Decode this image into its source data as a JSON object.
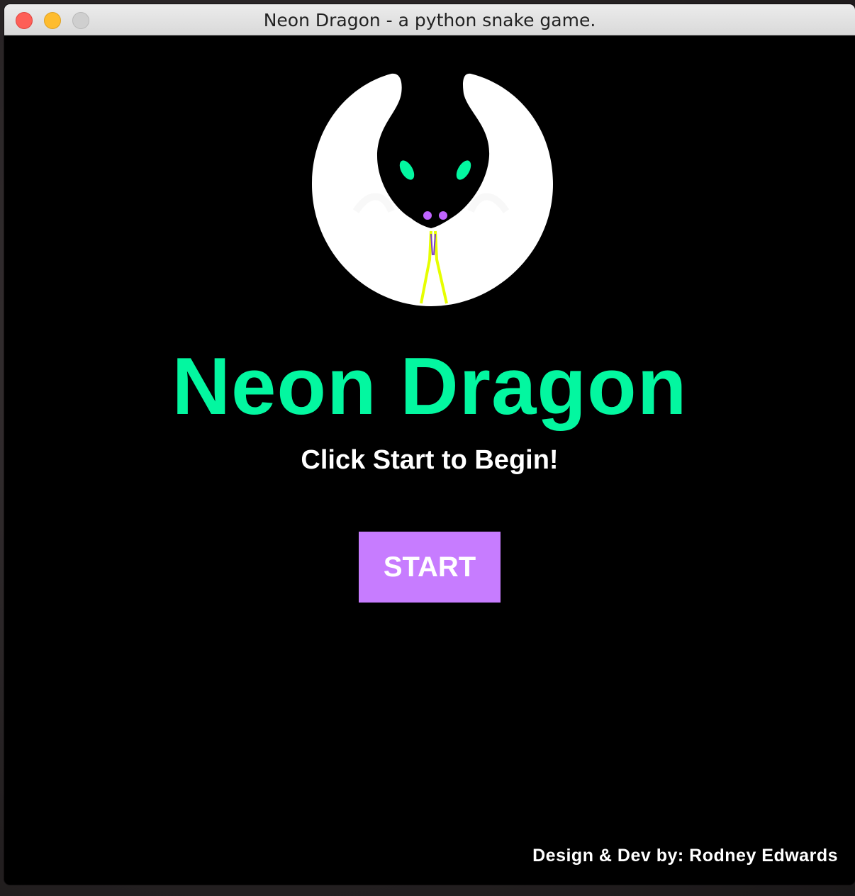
{
  "window": {
    "title": "Neon Dragon - a python snake game."
  },
  "game": {
    "title": "Neon Dragon",
    "subtitle": "Click Start to Begin!",
    "start_label": "START",
    "credits": "Design & Dev by: Rodney Edwards"
  },
  "colors": {
    "background": "#000000",
    "title": "#03f7a0",
    "button": "#c77cff",
    "text": "#ffffff",
    "logo_eyes": "#03f7a0",
    "logo_nostrils": "#c064ff",
    "logo_tongue": "#e6ff00"
  },
  "icons": {
    "logo": "dragon-logo-icon"
  }
}
